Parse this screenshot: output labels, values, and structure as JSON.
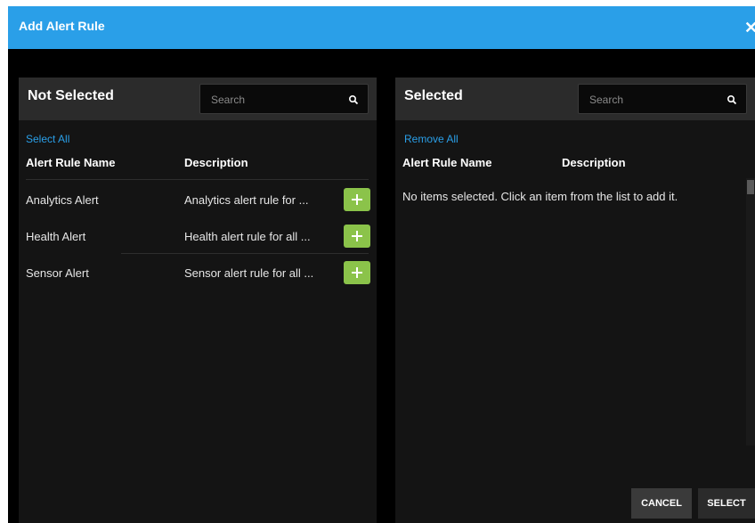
{
  "dialog": {
    "title": "Add Alert Rule",
    "close_icon": "close-icon"
  },
  "not_selected": {
    "title": "Not Selected",
    "search_placeholder": "Search",
    "select_all_label": "Select All",
    "columns": [
      "Alert Rule Name",
      "Description"
    ],
    "rows": [
      {
        "name": "Analytics Alert",
        "description": "Analytics alert rule for ..."
      },
      {
        "name": "Health Alert",
        "description": "Health alert rule for all ..."
      },
      {
        "name": "Sensor Alert",
        "description": "Sensor alert rule for all ..."
      }
    ]
  },
  "selected": {
    "title": "Selected",
    "search_placeholder": "Search",
    "remove_all_label": "Remove All",
    "columns": [
      "Alert Rule Name",
      "Description"
    ],
    "empty_message": "No items selected. Click an item from the list to add it."
  },
  "footer": {
    "cancel_label": "CANCEL",
    "select_label": "SELECT"
  },
  "colors": {
    "accent": "#2a9fe8",
    "add_button": "#8bc34a",
    "background": "#000000"
  }
}
